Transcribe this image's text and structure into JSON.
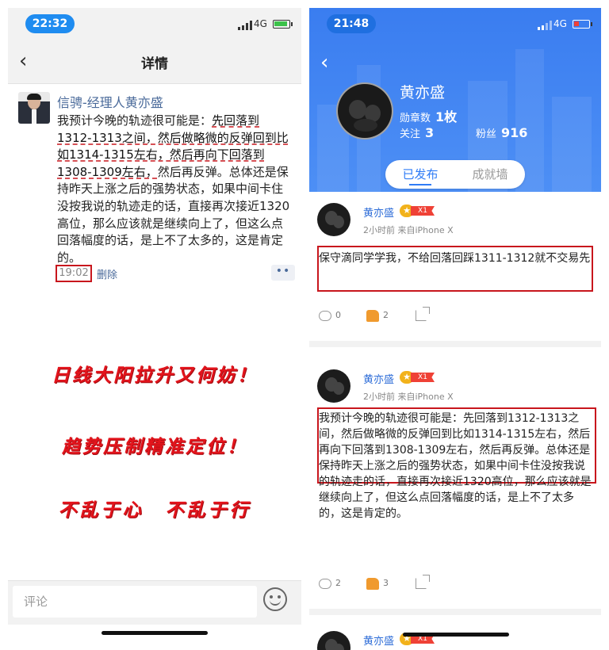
{
  "left": {
    "status": {
      "time": "22:32",
      "network": "4G",
      "battery_fraction": 0.85
    },
    "nav": {
      "title": "详情"
    },
    "post": {
      "author": "信骋-经理人黄亦盛",
      "text_highlight": "先回落到1312-1313之间，然后做略微的反弹回到比如1314-1315左右，然后再向下回落到1308-1309左右，",
      "text_prefix": "我预计今晚的轨迹很可能是：",
      "text_suffix": "然后再反弹。总体还是保持昨天上涨之后的强势状态，如果中间卡住没按我说的轨迹走的话，直接再次接近1320高位，那么应该就是继续向上了，但这么点回落幅度的话，是上不了太多的，这是肯定的。",
      "time": "19:02",
      "delete_label": "删除",
      "more_label": "••"
    },
    "slogans": [
      "日线大阳拉升又何妨！",
      "趋势压制精准定位！",
      "不乱于心　不乱于行"
    ],
    "comment": {
      "placeholder": "评论"
    }
  },
  "right": {
    "status": {
      "time": "21:48",
      "network": "4G",
      "battery_fraction": 0.3
    },
    "profile": {
      "name": "黄亦盛",
      "medals_label": "勋章数",
      "medals_value": "1枚",
      "follow_label": "关注",
      "follow_value": "3",
      "fans_label": "粉丝",
      "fans_value": "916"
    },
    "tabs": [
      {
        "label": "已发布",
        "active": true
      },
      {
        "label": "成就墙",
        "active": false
      }
    ],
    "posts": [
      {
        "author": "黄亦盛",
        "badge": "X1",
        "meta": "2小时前  来自iPhone X",
        "text": "保守滴同学学我，不给回落回踩1311-1312就不交易先",
        "comments": "0",
        "likes": "2"
      },
      {
        "author": "黄亦盛",
        "badge": "X1",
        "meta": "2小时前  来自iPhone X",
        "text": "我预计今晚的轨迹很可能是：先回落到1312-1313之间，然后做略微的反弹回到比如1314-1315左右，然后再向下回落到1308-1309左右，然后再反弹。总体还是保持昨天上涨之后的强势状态，如果中间卡住没按我说的轨迹走的话，直接再次接近1320高位，那么应该就是继续向上了，但这么点回落幅度的话，是上不了太多的，这是肯定的。",
        "comments": "2",
        "likes": "3"
      },
      {
        "author": "黄亦盛",
        "badge": "X1"
      }
    ]
  },
  "colors": {
    "accent": "#2f7cf6",
    "highlight_box": "#c8161d",
    "slogan": "#e3141c"
  }
}
